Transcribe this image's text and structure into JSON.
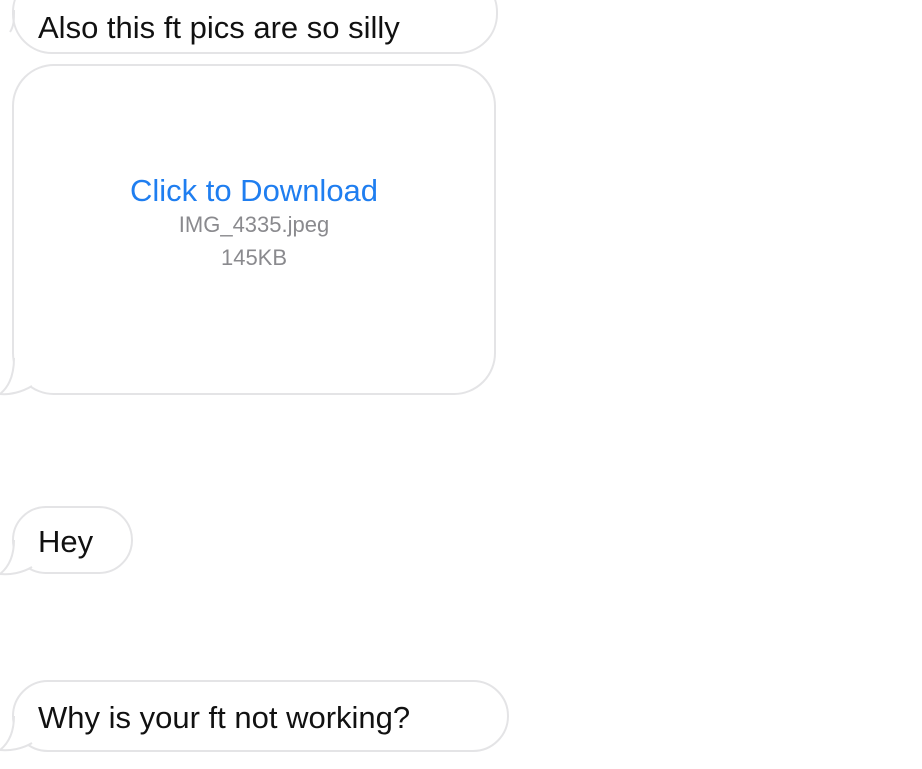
{
  "messages": [
    {
      "text": "Also this ft pics are so silly"
    },
    {
      "attachment": {
        "link_text": "Click to Download",
        "filename": "IMG_4335.jpeg",
        "size": "145KB"
      }
    },
    {
      "text": "Hey"
    },
    {
      "text": "Why is your ft not working?"
    }
  ],
  "colors": {
    "bubble_border": "#e4e4e6",
    "link": "#1f7ef0",
    "meta_text": "#8a8a8e"
  }
}
